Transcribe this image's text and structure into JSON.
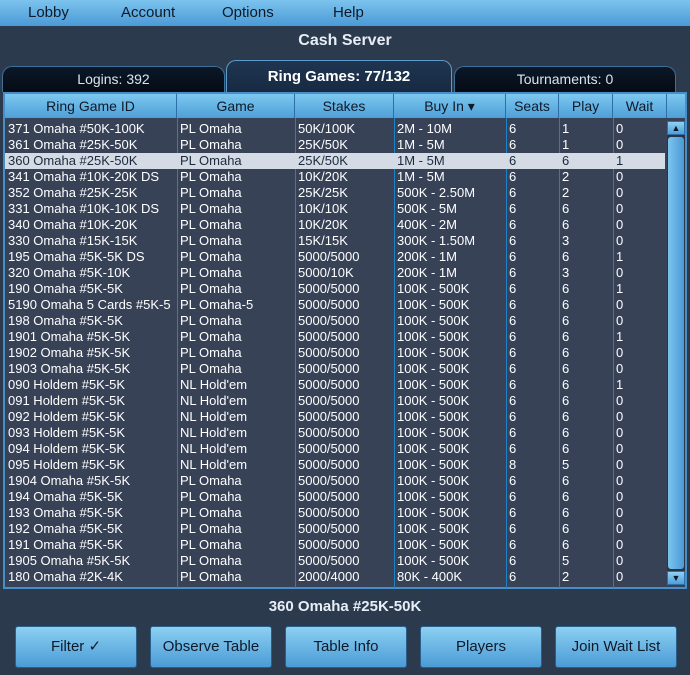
{
  "menu": [
    "Lobby",
    "Account",
    "Options",
    "Help"
  ],
  "server_title": "Cash Server",
  "tabs": [
    "Logins: 392",
    "Ring Games: 77/132",
    "Tournaments: 0"
  ],
  "columns": [
    "Ring Game ID",
    "Game",
    "Stakes",
    "Buy In ▾",
    "Seats",
    "Play",
    "Wait"
  ],
  "rows": [
    [
      "371 Omaha #50K-100K",
      "PL Omaha",
      "50K/100K",
      "2M - 10M",
      "6",
      "1",
      "0"
    ],
    [
      "361 Omaha #25K-50K",
      "PL Omaha",
      "25K/50K",
      "1M - 5M",
      "6",
      "1",
      "0"
    ],
    [
      "360 Omaha #25K-50K",
      "PL Omaha",
      "25K/50K",
      "1M - 5M",
      "6",
      "6",
      "1"
    ],
    [
      "341 Omaha #10K-20K DS",
      "PL Omaha",
      "10K/20K",
      "1M - 5M",
      "6",
      "2",
      "0"
    ],
    [
      "352 Omaha #25K-25K",
      "PL Omaha",
      "25K/25K",
      "500K - 2.50M",
      "6",
      "2",
      "0"
    ],
    [
      "331 Omaha #10K-10K DS",
      "PL Omaha",
      "10K/10K",
      "500K - 5M",
      "6",
      "6",
      "0"
    ],
    [
      "340 Omaha #10K-20K",
      "PL Omaha",
      "10K/20K",
      "400K - 2M",
      "6",
      "6",
      "0"
    ],
    [
      "330 Omaha #15K-15K",
      "PL Omaha",
      "15K/15K",
      "300K - 1.50M",
      "6",
      "3",
      "0"
    ],
    [
      "195 Omaha #5K-5K DS",
      "PL Omaha",
      "5000/5000",
      "200K - 1M",
      "6",
      "6",
      "1"
    ],
    [
      "320 Omaha #5K-10K",
      "PL Omaha",
      "5000/10K",
      "200K - 1M",
      "6",
      "3",
      "0"
    ],
    [
      "190 Omaha #5K-5K",
      "PL Omaha",
      "5000/5000",
      "100K - 500K",
      "6",
      "6",
      "1"
    ],
    [
      "5190 Omaha 5 Cards #5K-5",
      "PL Omaha-5",
      "5000/5000",
      "100K - 500K",
      "6",
      "6",
      "0"
    ],
    [
      "198 Omaha #5K-5K",
      "PL Omaha",
      "5000/5000",
      "100K - 500K",
      "6",
      "6",
      "0"
    ],
    [
      "1901 Omaha #5K-5K",
      "PL Omaha",
      "5000/5000",
      "100K - 500K",
      "6",
      "6",
      "1"
    ],
    [
      "1902 Omaha #5K-5K",
      "PL Omaha",
      "5000/5000",
      "100K - 500K",
      "6",
      "6",
      "0"
    ],
    [
      "1903 Omaha #5K-5K",
      "PL Omaha",
      "5000/5000",
      "100K - 500K",
      "6",
      "6",
      "0"
    ],
    [
      "090 Holdem #5K-5K",
      "NL Hold'em",
      "5000/5000",
      "100K - 500K",
      "6",
      "6",
      "1"
    ],
    [
      "091 Holdem #5K-5K",
      "NL Hold'em",
      "5000/5000",
      "100K - 500K",
      "6",
      "6",
      "0"
    ],
    [
      "092 Holdem #5K-5K",
      "NL Hold'em",
      "5000/5000",
      "100K - 500K",
      "6",
      "6",
      "0"
    ],
    [
      "093 Holdem #5K-5K",
      "NL Hold'em",
      "5000/5000",
      "100K - 500K",
      "6",
      "6",
      "0"
    ],
    [
      "094 Holdem #5K-5K",
      "NL Hold'em",
      "5000/5000",
      "100K - 500K",
      "6",
      "6",
      "0"
    ],
    [
      "095 Holdem #5K-5K",
      "NL Hold'em",
      "5000/5000",
      "100K - 500K",
      "8",
      "5",
      "0"
    ],
    [
      "1904 Omaha #5K-5K",
      "PL Omaha",
      "5000/5000",
      "100K - 500K",
      "6",
      "6",
      "0"
    ],
    [
      "194 Omaha #5K-5K",
      "PL Omaha",
      "5000/5000",
      "100K - 500K",
      "6",
      "6",
      "0"
    ],
    [
      "193 Omaha #5K-5K",
      "PL Omaha",
      "5000/5000",
      "100K - 500K",
      "6",
      "6",
      "0"
    ],
    [
      "192 Omaha #5K-5K",
      "PL Omaha",
      "5000/5000",
      "100K - 500K",
      "6",
      "6",
      "0"
    ],
    [
      "191 Omaha #5K-5K",
      "PL Omaha",
      "5000/5000",
      "100K - 500K",
      "6",
      "6",
      "0"
    ],
    [
      "1905 Omaha #5K-5K",
      "PL Omaha",
      "5000/5000",
      "100K - 500K",
      "6",
      "5",
      "0"
    ],
    [
      "180 Omaha #2K-4K",
      "PL Omaha",
      "2000/4000",
      "80K - 400K",
      "6",
      "2",
      "0"
    ]
  ],
  "selected_index": 2,
  "selected_table": "360 Omaha #25K-50K",
  "buttons": [
    "Filter ✓",
    "Observe Table",
    "Table Info",
    "Players",
    "Join Wait List"
  ],
  "scroll": {
    "up": "▲",
    "down": "▼"
  },
  "colors": {
    "accent": "#4a9ad6",
    "background": "#2c3a4e",
    "table_bg": "#374257",
    "selected_row": "#d4dbe4"
  }
}
